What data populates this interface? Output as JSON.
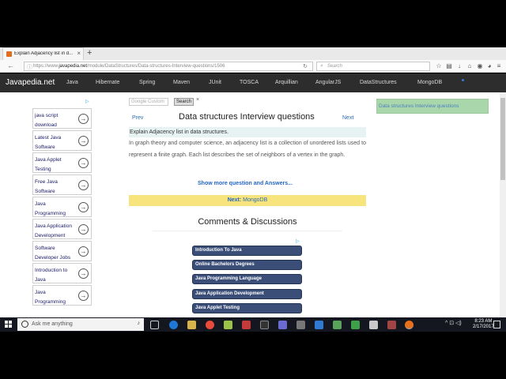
{
  "browser": {
    "tab_title": "Explain Adjacency list in d...",
    "tab_close": "×",
    "new_tab": "+",
    "url_prefix": "https://www.",
    "url_domain": "javapedia.net",
    "url_path": "/module/DataStructures/Data-structures-Interview-questions/1506",
    "search_placeholder": "Search",
    "back_glyph": "←",
    "reload_glyph": "↻"
  },
  "site": {
    "logo": "Javapedia.net",
    "menu": [
      "Java",
      "Hibernate",
      "Spring",
      "Maven",
      "JUnit",
      "TOSCA",
      "Arquillian",
      "AngularJS",
      "DataStructures",
      "MongoDB"
    ]
  },
  "left_ads": {
    "items": [
      "java script download",
      "Latest Java Software",
      "Java Applet Testing",
      "Free Java Software",
      "Java Programming",
      "Java Application Development",
      "Software Developer Jobs",
      "Introduction to Java",
      "Java Programming"
    ],
    "adchoice": "▷"
  },
  "search": {
    "placeholder": "Google  Custom",
    "button": "Search",
    "clear": "×"
  },
  "article": {
    "prev": "Prev",
    "next": "Next",
    "title": "Data structures Interview questions",
    "question": "Explain Adjacency list in data structures.",
    "answer": "In graph theory and computer science, an adjacency list is a collection of unordered lists used to represent a finite graph. Each list describes the set of neighbors of a vertex in the graph.",
    "more": "Show more question and Answers...",
    "next_label": "Next:",
    "next_topic": "MongoDB",
    "comments": "Comments & Discussions"
  },
  "bottom_ads": {
    "adchoice": "▷",
    "items": [
      "Introduction To Java",
      "Online Bachelors Degrees",
      "Java Programming Language",
      "Java Application Development",
      "Java Applet Testing"
    ]
  },
  "right_box": "Data structures Interview questions",
  "taskbar": {
    "search_placeholder": "Ask me anything",
    "time": "8:23 AM",
    "date": "2/17/2017",
    "tray": "^  ⊡  ◁)"
  },
  "colors": {
    "site_header": "#2d2d2d",
    "accent_link": "#2366c2",
    "next_bar": "#f8e47c",
    "right_box": "#a9d7ab",
    "ad_pill": "#3a4e78"
  }
}
